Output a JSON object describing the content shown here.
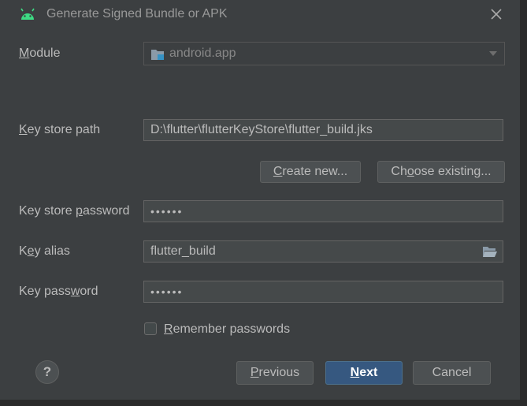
{
  "window": {
    "title": "Generate Signed Bundle or APK",
    "app_icon": "android-icon",
    "close_icon": "close-icon"
  },
  "module": {
    "label_first": "M",
    "label_rest": "odule",
    "value": "android.app",
    "icon": "module-folder-icon",
    "dropdown_icon": "chevron-down-icon"
  },
  "key_store_path": {
    "label_first": "K",
    "label_rest": "ey store path",
    "value": "D:\\flutter\\flutterKeyStore\\flutter_build.jks"
  },
  "buttons": {
    "create_new_pre": "",
    "create_new_mn": "C",
    "create_new_post": "reate new...",
    "choose_existing_pre": "Ch",
    "choose_existing_mn": "o",
    "choose_existing_post": "ose existing...",
    "previous_mn": "P",
    "previous_post": "revious",
    "next_mn": "N",
    "next_post": "ext",
    "cancel": "Cancel",
    "help": "?"
  },
  "key_store_password": {
    "label_pre": "Key store ",
    "label_mn": "p",
    "label_post": "assword",
    "value": "••••••"
  },
  "key_alias": {
    "label_pre": "K",
    "label_mn": "e",
    "label_post": "y alias",
    "value": "flutter_build",
    "icon": "folder-open-icon"
  },
  "key_password": {
    "label_pre": "Key pass",
    "label_mn": "w",
    "label_post": "ord",
    "value": "••••••"
  },
  "remember": {
    "label_mn": "R",
    "label_post": "emember passwords",
    "checked": false
  },
  "colors": {
    "background": "#3c3f41",
    "field": "#45494a",
    "primary_button": "#365880",
    "android_green": "#3ddc84"
  }
}
